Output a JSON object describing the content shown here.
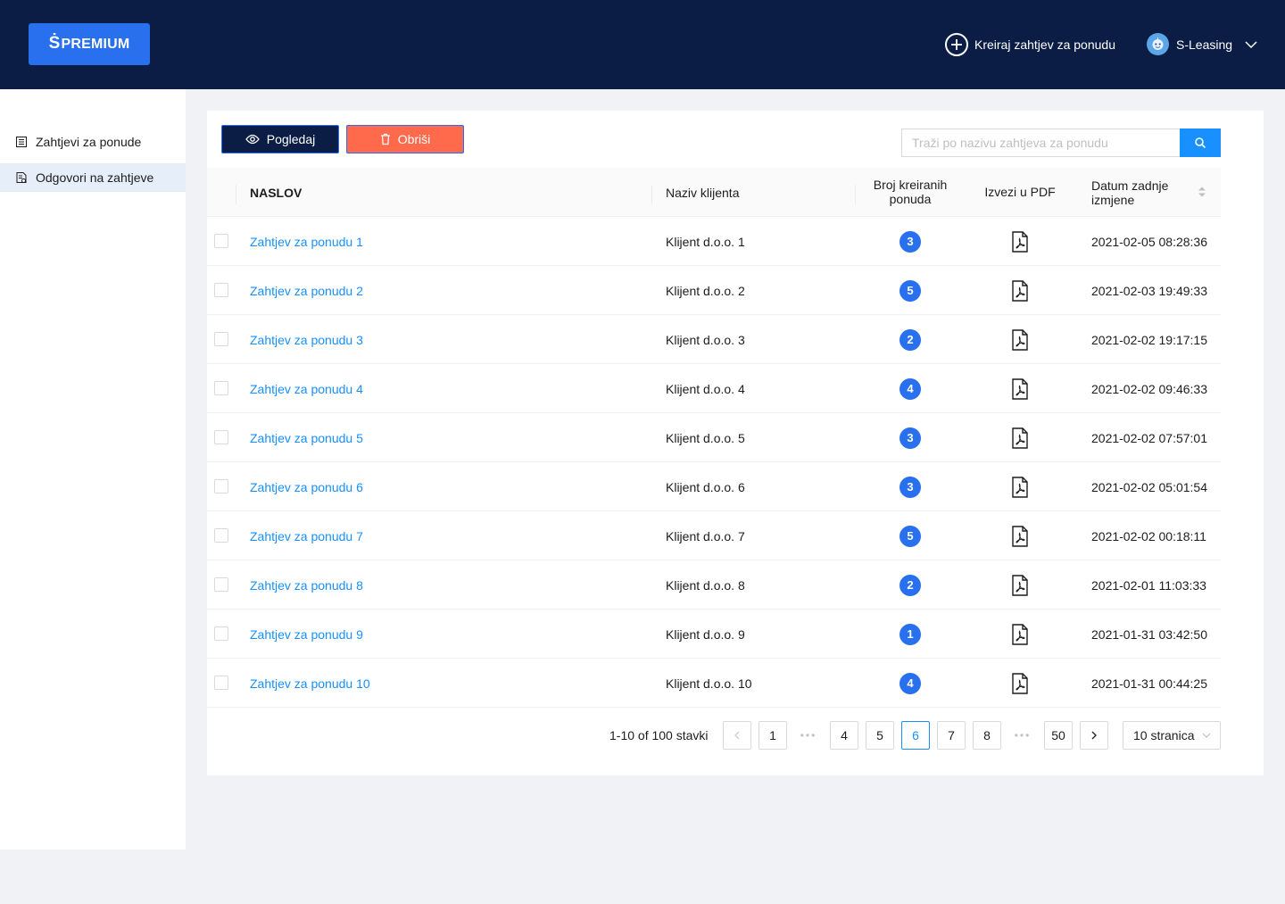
{
  "header": {
    "logo_mark": "Ṡ",
    "logo_text": "PREMIUM",
    "create_label": "Kreiraj zahtjev za ponudu",
    "user_name": "S-Leasing"
  },
  "sidebar": {
    "items": [
      {
        "label": "Zahtjevi za ponude",
        "icon": "list-doc-icon",
        "active": false
      },
      {
        "label": "Odgovori na zahtjeve",
        "icon": "doc-check-icon",
        "active": true
      }
    ]
  },
  "toolbar": {
    "view_label": "Pogledaj",
    "delete_label": "Obriši",
    "search_placeholder": "Traži po nazivu zahtjeva za ponudu"
  },
  "table": {
    "headers": {
      "title": "NASLOV",
      "client": "Naziv klijenta",
      "offers_line1": "Broj kreiranih",
      "offers_line2": "ponuda",
      "pdf": "Izvezi u PDF",
      "date_line1": "Datum zadnje",
      "date_line2": "izmjene"
    },
    "rows": [
      {
        "title": "Zahtjev za ponudu 1",
        "client": "Klijent d.o.o. 1",
        "offers": "3",
        "date": "2021-02-05 08:28:36"
      },
      {
        "title": "Zahtjev za ponudu 2",
        "client": "Klijent d.o.o. 2",
        "offers": "5",
        "date": "2021-02-03 19:49:33"
      },
      {
        "title": "Zahtjev za ponudu 3",
        "client": "Klijent d.o.o. 3",
        "offers": "2",
        "date": "2021-02-02 19:17:15"
      },
      {
        "title": "Zahtjev za ponudu 4",
        "client": "Klijent d.o.o. 4",
        "offers": "4",
        "date": "2021-02-02 09:46:33"
      },
      {
        "title": "Zahtjev za ponudu 5",
        "client": "Klijent d.o.o. 5",
        "offers": "3",
        "date": "2021-02-02 07:57:01"
      },
      {
        "title": "Zahtjev za ponudu 6",
        "client": "Klijent d.o.o. 6",
        "offers": "3",
        "date": "2021-02-02 05:01:54"
      },
      {
        "title": "Zahtjev za ponudu 7",
        "client": "Klijent d.o.o. 7",
        "offers": "5",
        "date": "2021-02-02 00:18:11"
      },
      {
        "title": "Zahtjev za ponudu 8",
        "client": "Klijent d.o.o. 8",
        "offers": "2",
        "date": "2021-02-01 11:03:33"
      },
      {
        "title": "Zahtjev za ponudu 9",
        "client": "Klijent d.o.o. 9",
        "offers": "1",
        "date": "2021-01-31 03:42:50"
      },
      {
        "title": "Zahtjev za ponudu 10",
        "client": "Klijent d.o.o. 10",
        "offers": "4",
        "date": "2021-01-31 00:44:25"
      }
    ]
  },
  "pagination": {
    "info": "1-10 of 100 stavki",
    "pages": [
      "1",
      "•••",
      "4",
      "5",
      "6",
      "7",
      "8",
      "•••",
      "50"
    ],
    "current": "6",
    "page_size": "10 stranica"
  },
  "colors": {
    "header_bg": "#0b1d45",
    "brand_blue": "#2870ed",
    "link_blue": "#1890ff",
    "delete_red": "#ff6a4d"
  }
}
